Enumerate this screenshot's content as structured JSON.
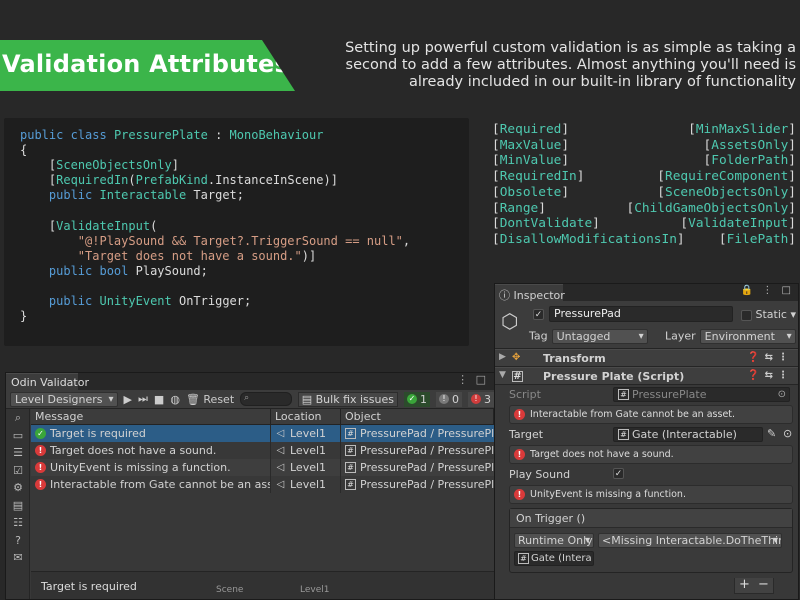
{
  "banner": {
    "title": "Validation Attributes"
  },
  "intro": {
    "text": "Setting up powerful custom validation is as simple as taking a second to add a few attributes. Almost anything you'll need is already included in our built-in library of functionality"
  },
  "code": {
    "l1a": "public class",
    "l1b": "PressurePlate",
    "l1c": " : ",
    "l1d": "MonoBehaviour",
    "l2": "{",
    "l3a": "[",
    "l3b": "SceneObjectsOnly",
    "l3c": "]",
    "l4a": "[",
    "l4b": "RequiredIn",
    "l4c": "(",
    "l4d": "PrefabKind",
    "l4e": ".InstanceInScene)]",
    "l5a": "public",
    "l5b": "Interactable",
    "l5c": " Target;",
    "l6a": "[",
    "l6b": "ValidateInput",
    "l6c": "(",
    "l7": "\"@!PlaySound && Target?.TriggerSound == null\"",
    "l7c": ",",
    "l8": "\"Target does not have a sound.\"",
    "l8c": ")]",
    "l9a": "public bool",
    "l9b": " PlaySound;",
    "l10a": "public",
    "l10b": "UnityEvent",
    "l10c": " OnTrigger;",
    "l11": "}"
  },
  "attributes": {
    "left": [
      "Required",
      "MaxValue",
      "MinValue",
      "RequiredIn",
      "Obsolete",
      "Range",
      "DontValidate",
      "DisallowModificationsIn"
    ],
    "right": [
      "MinMaxSlider",
      "AssetsOnly",
      "FolderPath",
      "RequireComponent",
      "SceneObjectsOnly",
      "ChildGameObjectsOnly",
      "ValidateInput",
      "FilePath"
    ]
  },
  "validator": {
    "tab": "Odin Validator",
    "profile": "Level Designers",
    "reset": "Reset",
    "search_placeholder": "",
    "bulk": "Bulk fix issues",
    "count_ok": "1",
    "count_warn": "0",
    "count_err": "3",
    "col_message": "Message",
    "col_location": "Location",
    "col_object": "Object",
    "rows": [
      {
        "message": "Target is required",
        "location": "Level1",
        "object": "PressurePad / PressurePlate"
      },
      {
        "message": "Target does not have a sound.",
        "location": "Level1",
        "object": "PressurePad / PressurePlate"
      },
      {
        "message": "UnityEvent is missing a function.",
        "location": "Level1",
        "object": "PressurePad / PressurePlate"
      },
      {
        "message": "Interactable from Gate cannot be an asset.",
        "location": "Level1",
        "object": "PressurePad / PressurePlate"
      }
    ],
    "detail_message": "Target is required",
    "detail_scene_label": "Scene",
    "detail_scene_value": "Level1"
  },
  "inspector": {
    "tab": "Inspector",
    "object_name": "PressurePad",
    "static_label": "Static",
    "tag_label": "Tag",
    "tag_value": "Untagged",
    "layer_label": "Layer",
    "layer_value": "Environment",
    "transform": "Transform",
    "script_comp": "Pressure Plate (Script)",
    "script_label": "Script",
    "script_value": "PressurePlate",
    "err_asset": "Interactable from Gate cannot be an asset.",
    "target_label": "Target",
    "target_value": "Gate (Interactable)",
    "err_sound": "Target does not have a sound.",
    "playsound_label": "Play Sound",
    "err_event": "UnityEvent is missing a function.",
    "event_title": "On Trigger ()",
    "runtime": "Runtime Only",
    "missing_fn": "<Missing Interactable.DoTheThing>",
    "event_obj": "Gate (Intera",
    "plus": "+",
    "minus": "−"
  },
  "colors": {
    "banner": "#3bb54a",
    "selection": "#2c5d87",
    "error": "#d93a3a",
    "ok": "#3aa63a",
    "attribute": "#4ec9b0"
  }
}
